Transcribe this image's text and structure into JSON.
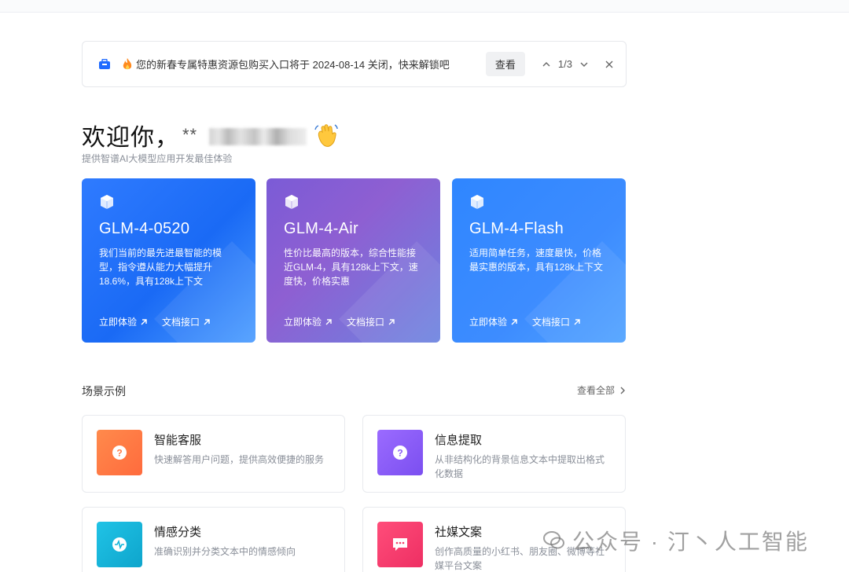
{
  "notice": {
    "text": "您的新春专属特惠资源包购买入口将于 2024-08-14 关闭，快来解锁吧",
    "view_label": "查看",
    "pager": "1/3"
  },
  "welcome": {
    "greeting": "欢迎你，",
    "username_masked": "**",
    "subtitle": "提供智谱AI大模型应用开发最佳体验"
  },
  "models": [
    {
      "name": "GLM-4-0520",
      "desc": "我们当前的最先进最智能的模型，指令遵从能力大幅提升18.6%，具有128k上下文",
      "try_label": "立即体验",
      "docs_label": "文档接口"
    },
    {
      "name": "GLM-4-Air",
      "desc": "性价比最高的版本，综合性能接近GLM-4，具有128k上下文，速度快，价格实惠",
      "try_label": "立即体验",
      "docs_label": "文档接口"
    },
    {
      "name": "GLM-4-Flash",
      "desc": "适用简单任务，速度最快，价格最实惠的版本，具有128k上下文",
      "try_label": "立即体验",
      "docs_label": "文档接口"
    }
  ],
  "scenes": {
    "title": "场景示例",
    "view_all": "查看全部",
    "items": [
      {
        "title": "智能客服",
        "desc": "快速解答用户问题，提供高效便捷的服务",
        "color": "#ff7a45"
      },
      {
        "title": "信息提取",
        "desc": "从非结构化的背景信息文本中提取出格式化数据",
        "color": "#8b5cf6"
      },
      {
        "title": "情感分类",
        "desc": "准确识别并分类文本中的情感倾向",
        "color": "#13b5d9"
      },
      {
        "title": "社媒文案",
        "desc": "创作高质量的小红书、朋友圈、微博等社媒平台文案",
        "color": "#f43f6b"
      }
    ]
  },
  "watermark": "公众号 · 汀丶人工智能"
}
